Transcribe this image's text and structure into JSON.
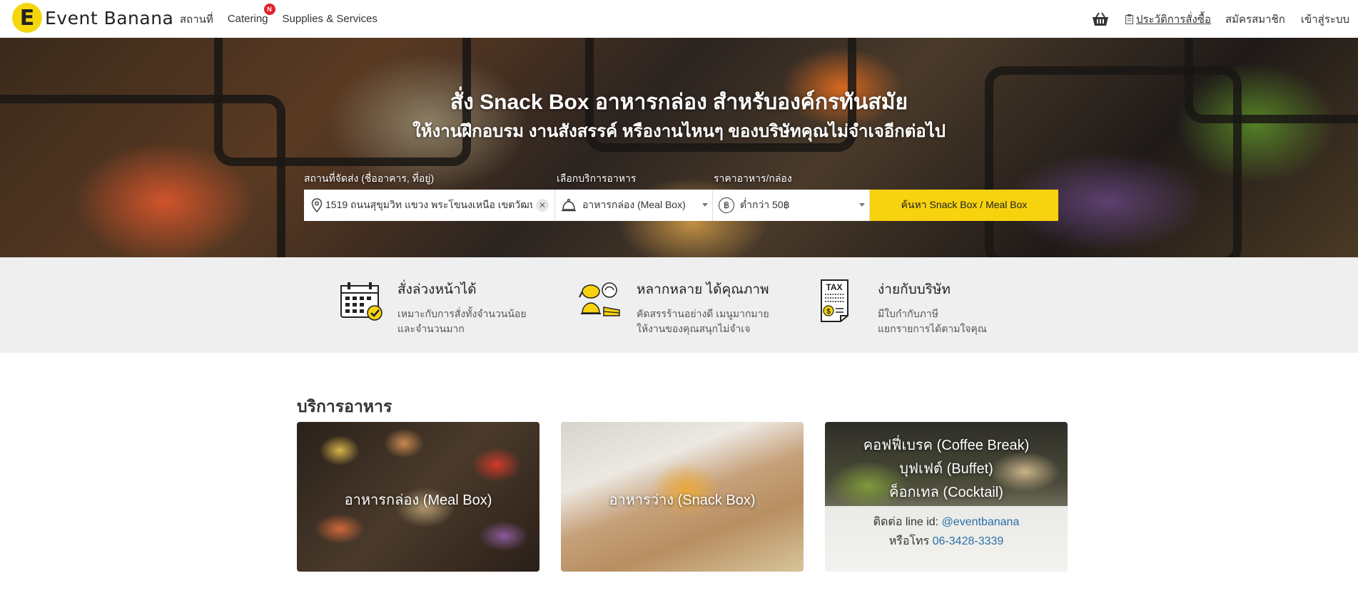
{
  "brand": {
    "logo_letter": "E",
    "name": "Event Banana"
  },
  "nav": {
    "links": [
      "สถานที่",
      "Catering",
      "Supplies & Services"
    ],
    "catering_badge": "N",
    "history": "ประวัติการสั่งซื้อ",
    "register": "สมัครสมาชิก",
    "login": "เข้าสู่ระบบ"
  },
  "hero": {
    "title": "สั่ง Snack Box อาหารกล่อง สำหรับองค์กรทันสมัย",
    "subtitle": "ให้งานฝึกอบรม งานสังสรรค์ หรืองานไหนๆ ของบริษัทคุณไม่จำเจอีกต่อไป"
  },
  "search": {
    "location_label": "สถานที่จัดส่ง (ชื่ออาคาร, ที่อยู่)",
    "location_value": "1519 ถนนสุขุมวิท แขวง พระโขนงเหนือ เขตวัฒนา",
    "service_label": "เลือกบริการอาหาร",
    "service_value": "อาหารกล่อง (Meal Box)",
    "price_label": "ราคาอาหาร/กล่อง",
    "price_value": "ต่ำกว่า 50฿",
    "button": "ค้นหา Snack Box / Meal Box"
  },
  "features": [
    {
      "title": "สั่งล่วงหน้าได้",
      "desc1": "เหมาะกับการสั่งทั้งจำนวนน้อย",
      "desc2": "และจำนวนมาก",
      "icon": "calendar-check-icon"
    },
    {
      "title": "หลากหลาย ได้คุณภาพ",
      "desc1": "คัดสรรร้านอย่างดี เมนูมากมาย",
      "desc2": "ให้งานของคุณสนุกไม่จำเจ",
      "icon": "food-variety-icon"
    },
    {
      "title": "ง่ายกับบริษัท",
      "desc1": "มีใบกำกับภาษี",
      "desc2": "แยกรายการได้ตามใจคุณ",
      "icon": "tax-invoice-icon",
      "icon_text": "TAX"
    }
  ],
  "services": {
    "title": "บริการอาหาร",
    "cards": [
      {
        "label": "อาหารกล่อง (Meal Box)"
      },
      {
        "label": "อาหารว่าง (Snack Box)"
      },
      {
        "line1": "คอฟฟี่เบรค (Coffee Break)",
        "line2": "บุฟเฟต์ (Buffet)",
        "line3": "ค็อกเทล (Cocktail)",
        "contact_prefix": "ติดต่อ line id: ",
        "line_id": "@eventbanana",
        "phone_prefix": "หรือโทร ",
        "phone": "06-3428-3339"
      }
    ]
  },
  "colors": {
    "accent": "#f7d20f",
    "badge": "#e0232a",
    "link": "#2b6fa8"
  }
}
